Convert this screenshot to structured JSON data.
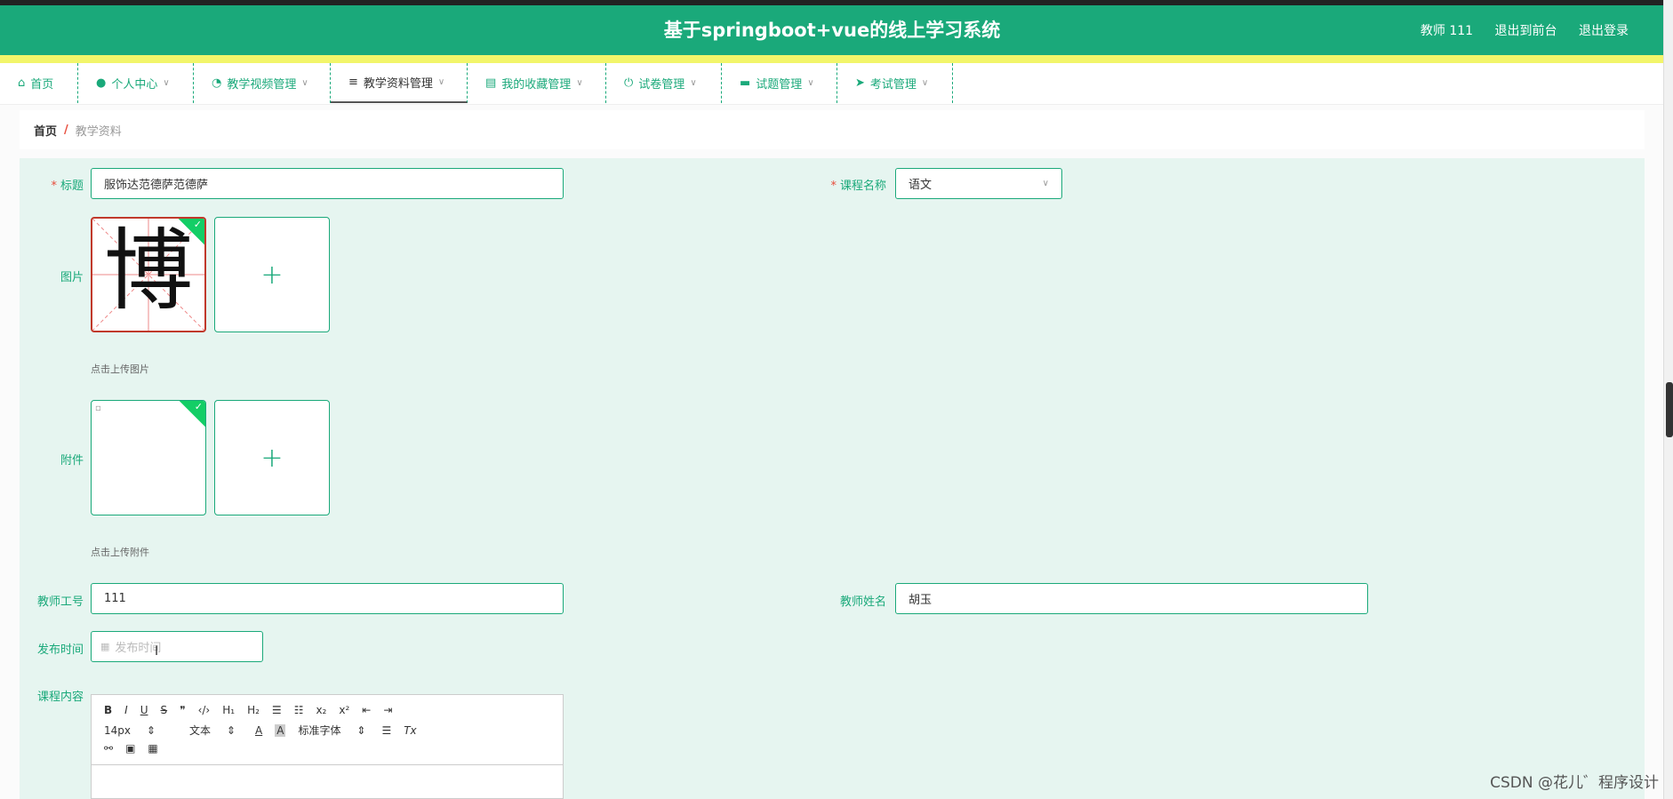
{
  "app": {
    "title": "基于springboot+vue的线上学习系统",
    "user": "教师 111",
    "go_front": "退出到前台",
    "logout": "退出登录"
  },
  "nav": {
    "items": [
      {
        "label": "首页",
        "icon": "home-icon"
      },
      {
        "label": "个人中心",
        "icon": "user-icon"
      },
      {
        "label": "教学视频管理",
        "icon": "gauge-icon"
      },
      {
        "label": "教学资料管理",
        "icon": "list-icon",
        "active": true
      },
      {
        "label": "我的收藏管理",
        "icon": "clipboard-icon"
      },
      {
        "label": "试卷管理",
        "icon": "power-icon"
      },
      {
        "label": "试题管理",
        "icon": "monitor-icon"
      },
      {
        "label": "考试管理",
        "icon": "send-icon"
      }
    ]
  },
  "breadcrumb": {
    "home": "首页",
    "separator": "/",
    "current": "教学资料"
  },
  "form": {
    "title_label": "标题",
    "title_value": "服饰达范德萨范德萨",
    "course_label": "课程名称",
    "course_value": "语文",
    "image_label": "图片",
    "image_char": "博",
    "image_tip": "点击上传图片",
    "attach_label": "附件",
    "attach_tip": "点击上传附件",
    "teacher_id_label": "教师工号",
    "teacher_id_value": "111",
    "teacher_name_label": "教师姓名",
    "teacher_name_value": "胡玉",
    "publish_label": "发布时间",
    "publish_placeholder": "发布时间",
    "content_label": "课程内容"
  },
  "editor": {
    "size": "14px",
    "format": "文本",
    "font": "标准字体"
  },
  "watermark": "CSDN @花儿゛程序设计",
  "colors": {
    "primary": "#1aa97a",
    "accent_bar": "#f2f56a",
    "form_bg": "#e6f5f0"
  }
}
